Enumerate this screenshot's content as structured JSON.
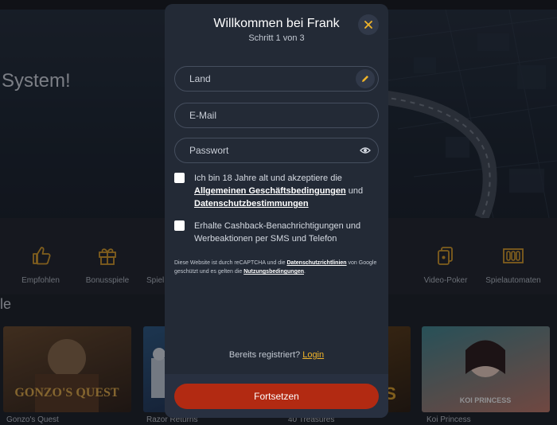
{
  "background": {
    "hero_text": "System!",
    "categories": [
      {
        "label": "Empfohlen",
        "icon": "thumbs-up-icon"
      },
      {
        "label": "Bonusspiele",
        "icon": "gift-icon"
      },
      {
        "label": "Spiel",
        "icon": "game-icon"
      },
      {
        "label": "Video-Poker",
        "icon": "cards-icon"
      },
      {
        "label": "Spielautomaten",
        "icon": "slot-machine-icon"
      }
    ],
    "section_title": "le",
    "tiles": [
      {
        "label": "Gonzo's Quest",
        "logo_text": "GONZO'S QUEST",
        "color": "#4a2f1e"
      },
      {
        "label": "Razor Returns",
        "color": "#24425e"
      },
      {
        "label": "40 Treasures",
        "logo_text": "RES",
        "color": "#3b2a18"
      },
      {
        "label": "Koi Princess",
        "logo_text": "KOI PRINCESS",
        "color": "#2a5a66"
      }
    ],
    "accent_color": "#f0b429"
  },
  "modal": {
    "title": "Willkommen bei Frank",
    "step": "Schritt 1 von 3",
    "close_icon": "close-icon",
    "fields": {
      "country_placeholder": "Land",
      "email_placeholder": "E-Mail",
      "password_placeholder": "Passwort"
    },
    "terms": {
      "text_before": "Ich bin 18 Jahre alt und akzeptiere die",
      "link_terms": "Allgemeinen Geschäftsbedingungen",
      "text_and": "und",
      "link_privacy": "Datenschutzbestimmungen"
    },
    "marketing": {
      "text": "Erhalte Cashback-Benachrichtigungen und Werbeaktionen per SMS und Telefon"
    },
    "recaptcha": {
      "text_1": "Diese Website ist durch reCAPTCHA und die",
      "link_privacy": "Datenschutzrichtlinien",
      "text_2": "von Google geschützt und es gelten die",
      "link_terms": "Nutzungsbedingungen",
      "text_3": "."
    },
    "login": {
      "prompt": "Bereits registriert?",
      "link": "Login"
    },
    "submit_label": "Fortsetzen",
    "colors": {
      "submit": "#b22a12",
      "accent": "#f0b429"
    }
  }
}
